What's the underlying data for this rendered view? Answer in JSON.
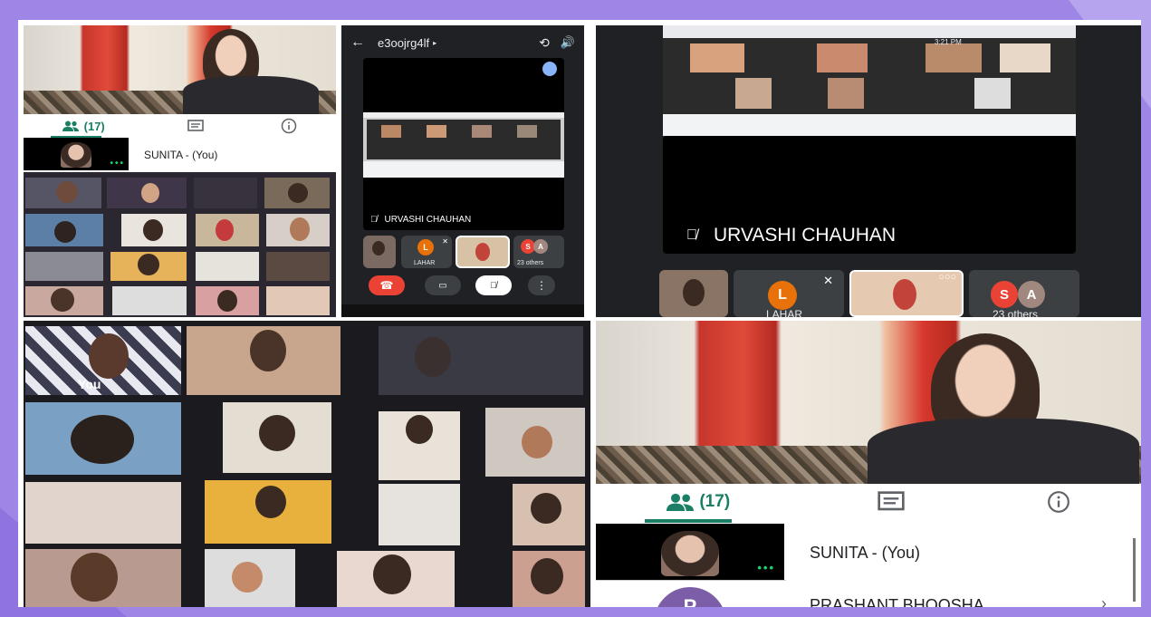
{
  "colors": {
    "accent": "#1a7f64",
    "end_call": "#ea4335",
    "avatar_orange": "#e8710a",
    "avatar_brown": "#a1887f",
    "avatar_purple": "#7b5ea7",
    "bg": "#9d86e6"
  },
  "top_left": {
    "tabs": [
      {
        "label": "(17)",
        "icon": "people-icon"
      },
      {
        "label": "",
        "icon": "chat-icon"
      },
      {
        "label": "",
        "icon": "info-icon"
      }
    ],
    "self_name": "SUNITA - (You)",
    "dots": "•••"
  },
  "phone": {
    "meeting_code": "e3oojrg4lf",
    "speaker_name": "URVASHI CHAUHAN",
    "tile_lahar": "LAHAR",
    "avatar_l": "L",
    "avatar_s": "S",
    "avatar_a": "A",
    "others": "23 others"
  },
  "top_right": {
    "speaker_name": "URVASHI CHAUHAN",
    "time_text": "3:21 PM",
    "avatar_l": "L",
    "tile_lahar": "LAHAR",
    "avatar_s": "S",
    "avatar_a": "A",
    "others": "23 others"
  },
  "bottom_left": {
    "you_label": "You"
  },
  "bottom_right": {
    "tabs": [
      {
        "label": "(17)",
        "icon": "people-icon"
      },
      {
        "label": "",
        "icon": "chat-icon"
      },
      {
        "label": "",
        "icon": "info-icon"
      }
    ],
    "self_name": "SUNITA - (You)",
    "next_participant": "PRASHANT BHOOSHA",
    "next_avatar": "P",
    "dots": "•••"
  }
}
